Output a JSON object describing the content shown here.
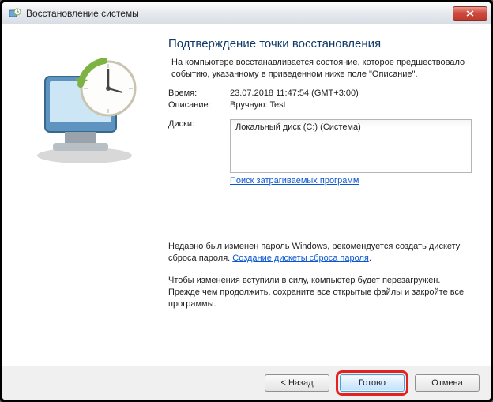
{
  "window": {
    "title": "Восстановление системы"
  },
  "page": {
    "heading": "Подтверждение точки восстановления",
    "intro": "На компьютере восстанавливается состояние, которое предшествовало событию, указанному в приведенном ниже поле \"Описание\"."
  },
  "fields": {
    "time_label": "Время:",
    "time_value": "23.07.2018 11:47:54 (GMT+3:00)",
    "desc_label": "Описание:",
    "desc_value": "Вручную: Test",
    "disks_label": "Диски:",
    "disks": [
      "Локальный диск (C:) (Система)"
    ],
    "scan_link": "Поиск затрагиваемых программ"
  },
  "notes": {
    "pw_note_text": "Недавно был изменен пароль Windows, рекомендуется создать дискету сброса пароля. ",
    "pw_note_link": "Создание дискеты сброса пароля",
    "restart_note": "Чтобы изменения вступили в силу, компьютер будет перезагружен. Прежде чем продолжить, сохраните все открытые файлы и закройте все программы."
  },
  "buttons": {
    "back": "< Назад",
    "finish": "Готово",
    "cancel": "Отмена"
  }
}
